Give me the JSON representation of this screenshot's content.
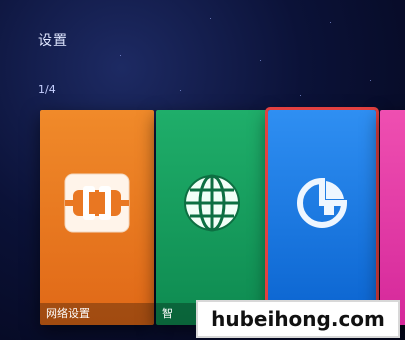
{
  "header": {
    "title": "设置",
    "page_indicator": "1/4"
  },
  "tiles": [
    {
      "label": "网络设置",
      "icon": "network-plug-icon",
      "color": "#e9761f"
    },
    {
      "label": "智",
      "icon": "globe-icon",
      "color": "#18a064"
    },
    {
      "label": "",
      "icon": "pie-chart-icon",
      "color": "#1e7fe6",
      "selected_border": "#e24141"
    },
    {
      "label": "",
      "icon": "",
      "color": "#e13fa8"
    }
  ],
  "watermark": {
    "text": "hubeihong.com"
  }
}
